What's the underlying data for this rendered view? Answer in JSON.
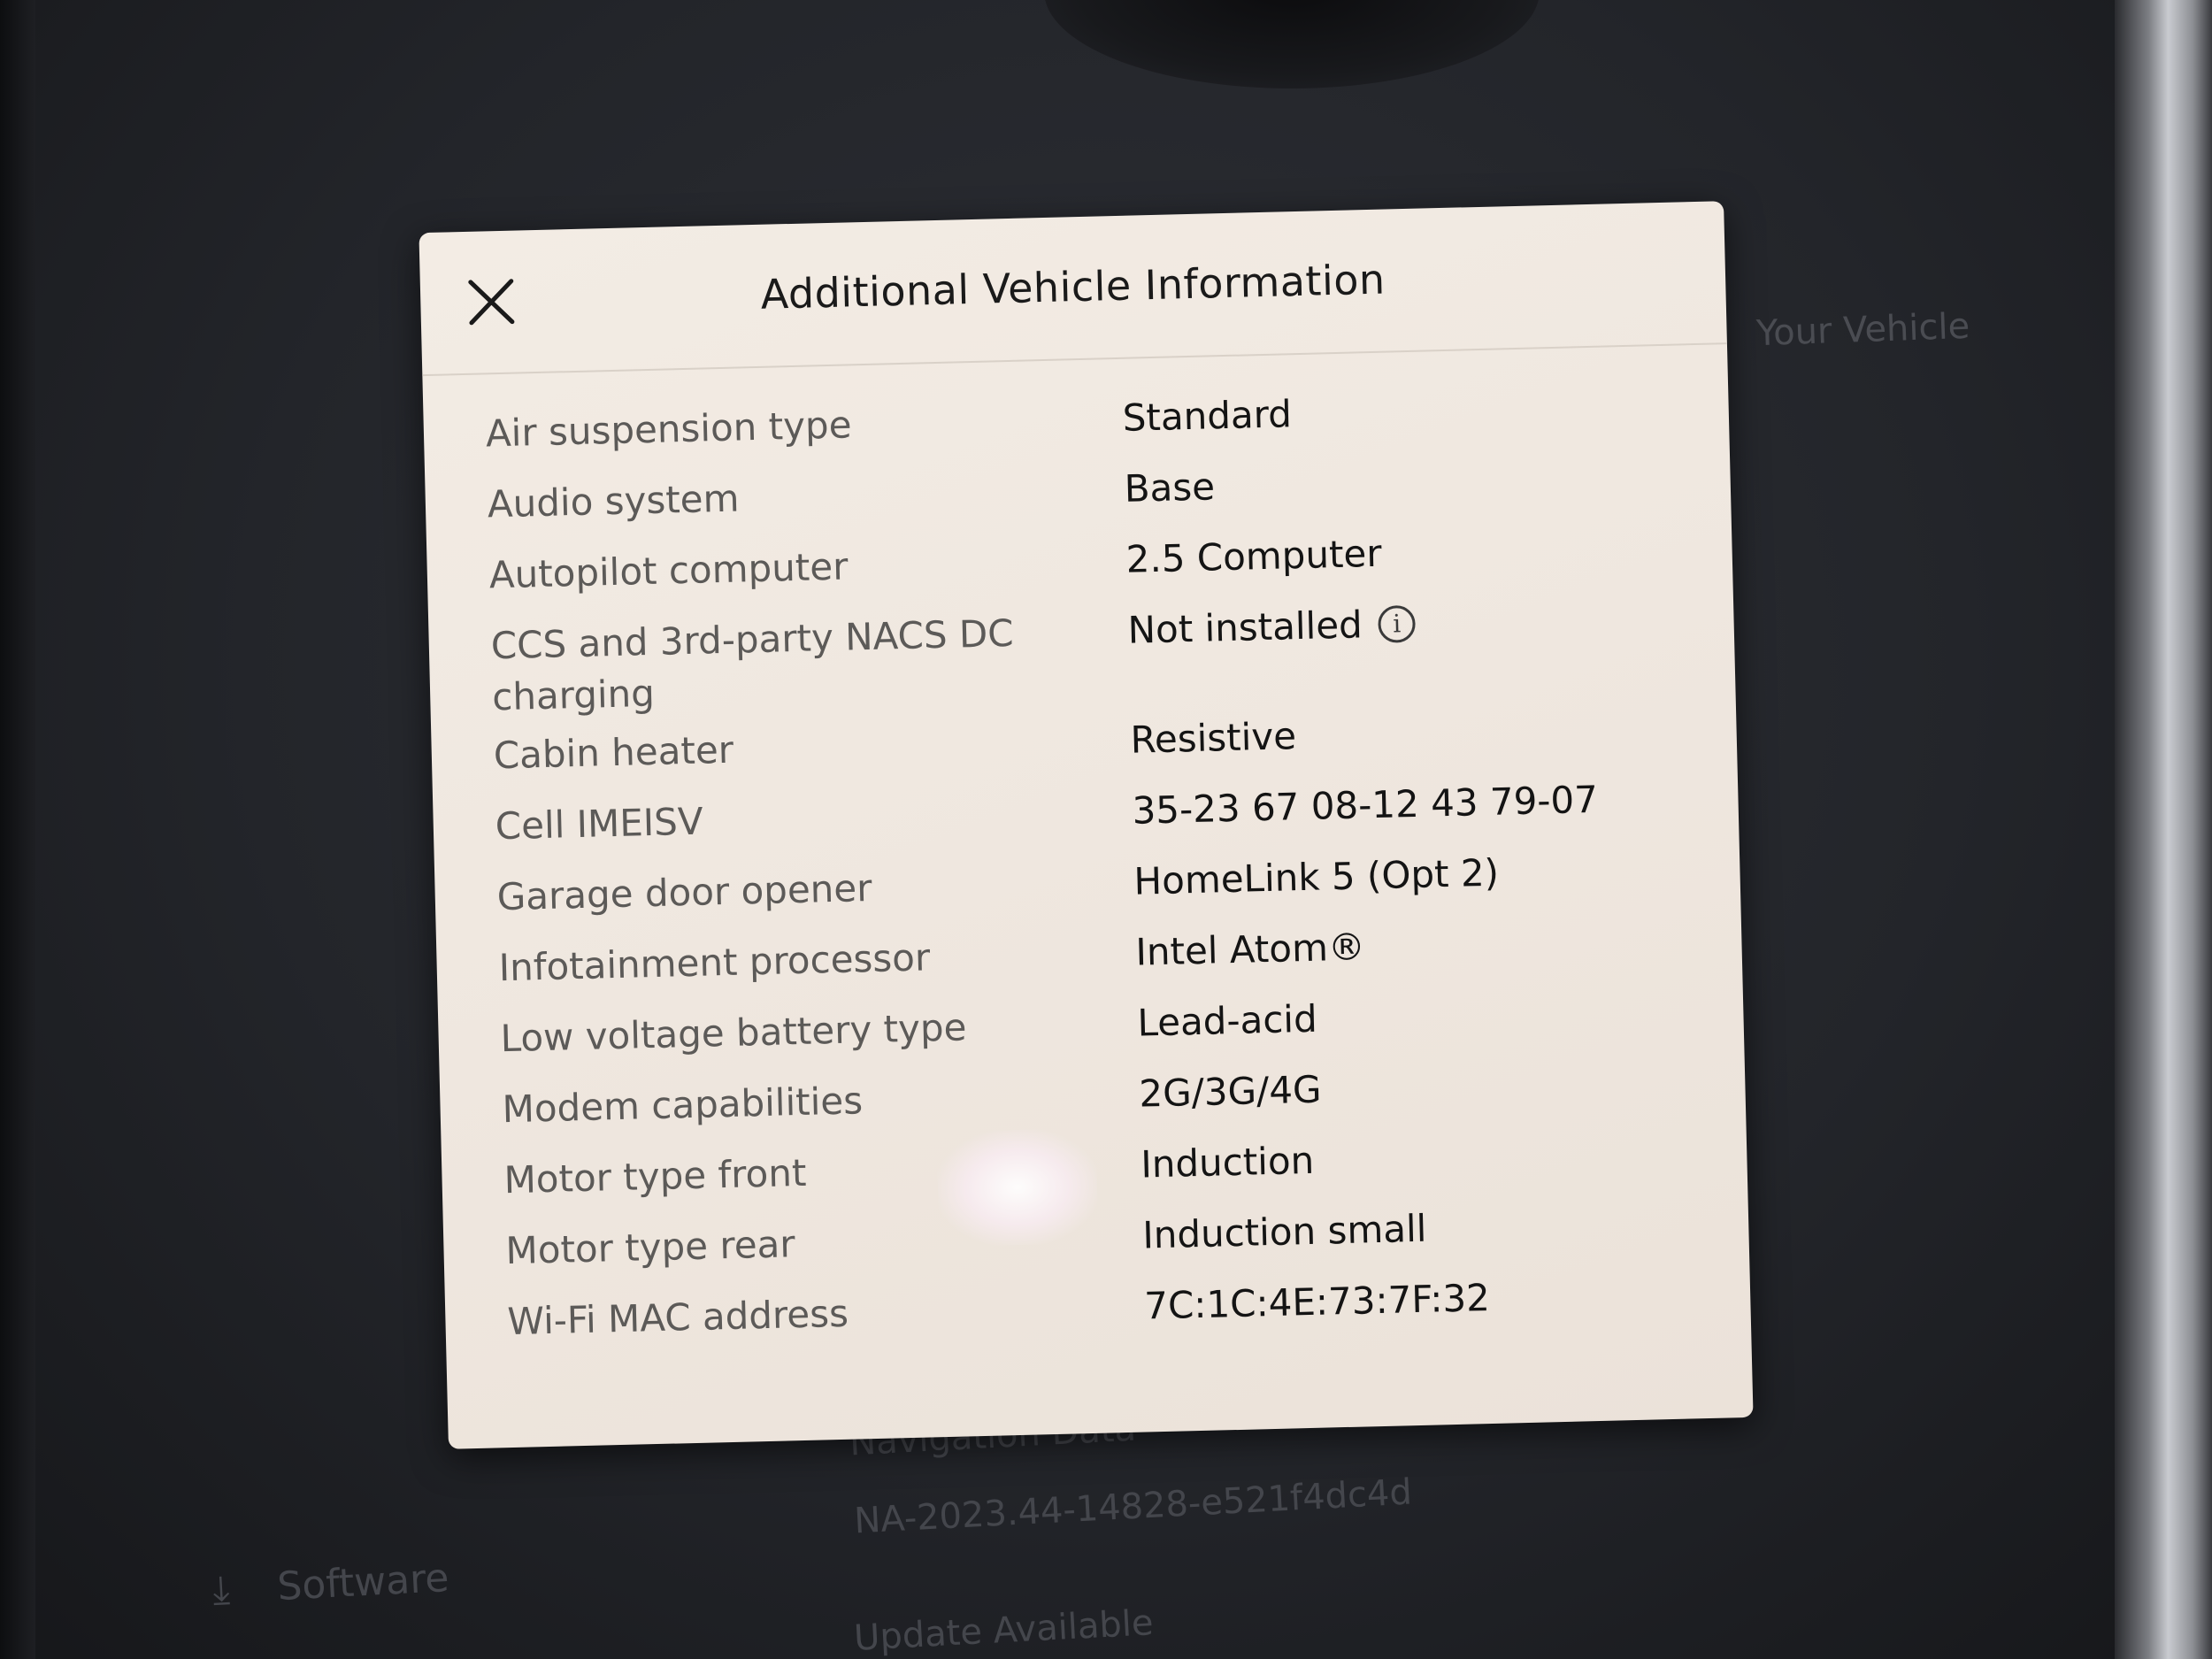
{
  "modal": {
    "title": "Additional Vehicle Information",
    "close_icon": "close-icon",
    "rows": [
      {
        "label": "Air suspension type",
        "value": "Standard"
      },
      {
        "label": "Audio system",
        "value": "Base"
      },
      {
        "label": "Autopilot computer",
        "value": "2.5 Computer"
      },
      {
        "label": "CCS and 3rd-party NACS DC charging",
        "value": "Not installed",
        "icon": "info-icon"
      },
      {
        "label": "Cabin heater",
        "value": "Resistive"
      },
      {
        "label": "Cell IMEISV",
        "value": "35-23 67 08-12 43 79-07"
      },
      {
        "label": "Garage door opener",
        "value": "HomeLink 5 (Opt 2)"
      },
      {
        "label": "Infotainment processor",
        "value": "Intel Atom®"
      },
      {
        "label": "Low voltage battery type",
        "value": "Lead-acid"
      },
      {
        "label": "Modem capabilities",
        "value": "2G/3G/4G"
      },
      {
        "label": "Motor type front",
        "value": "Induction"
      },
      {
        "label": "Motor type rear",
        "value": "Induction small"
      },
      {
        "label": "Wi-Fi MAC address",
        "value": "7C:1C:4E:73:7F:32"
      }
    ]
  },
  "background": {
    "your_vehicle": "Your Vehicle",
    "nav_software_label": "Software",
    "navigation_data_title": "Navigation Data",
    "navigation_data_value": "NA-2023.44-14828-e521f4dc4d",
    "update_status": "Update Available"
  }
}
